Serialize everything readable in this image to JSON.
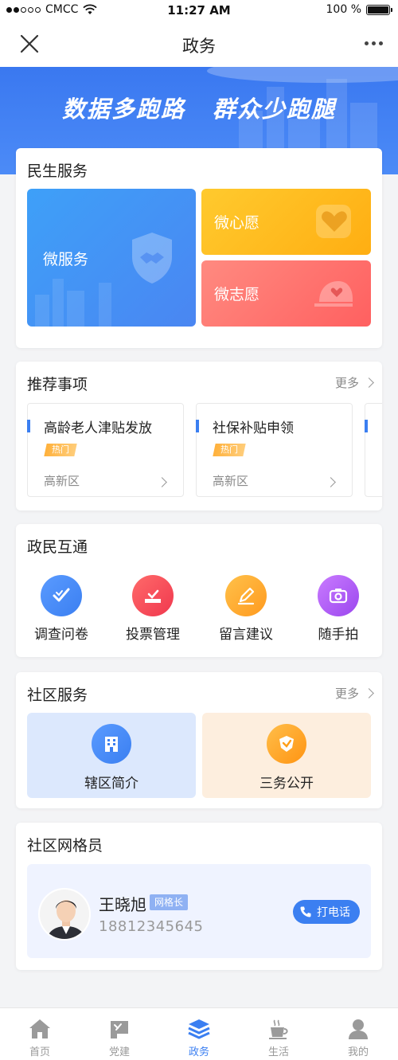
{
  "status_bar": {
    "carrier": "CMCC",
    "time": "11:27 AM",
    "battery": "100 %",
    "battery_level": 1.0
  },
  "nav": {
    "title": "政务",
    "icons": {
      "close": "close-icon",
      "more": "more-dots-icon"
    }
  },
  "banner": {
    "slogan_left": "数据多跑路",
    "slogan_right": "群众少跑腿"
  },
  "livelihood": {
    "title": "民生服务",
    "tiles": [
      {
        "label": "微服务",
        "icon": "handshake-shield-icon",
        "color": "#4a8ff5"
      },
      {
        "label": "微心愿",
        "icon": "heart-icon",
        "color": "#ffb81c"
      },
      {
        "label": "微志愿",
        "icon": "volunteer-cap-icon",
        "color": "#ff6b6b"
      }
    ]
  },
  "recommended": {
    "title": "推荐事项",
    "more": "更多",
    "items": [
      {
        "title": "高龄老人津贴发放",
        "tag": "热门",
        "area": "高新区"
      },
      {
        "title": "社保补贴申领",
        "tag": "热门",
        "area": "高新区"
      }
    ]
  },
  "interaction": {
    "title": "政民互通",
    "tools": [
      {
        "label": "调查问卷",
        "icon": "survey-check-icon",
        "color": "#3b7ff1"
      },
      {
        "label": "投票管理",
        "icon": "vote-box-icon",
        "color": "#f24b5c"
      },
      {
        "label": "留言建议",
        "icon": "pencil-icon",
        "color": "#ffa726"
      },
      {
        "label": "随手拍",
        "icon": "camera-icon",
        "color": "#b15cf0"
      }
    ]
  },
  "community": {
    "title": "社区服务",
    "more": "更多",
    "tiles": [
      {
        "label": "辖区简介",
        "icon": "building-icon",
        "color": "#3b7ff1"
      },
      {
        "label": "三务公开",
        "icon": "badge-shield-icon",
        "color": "#ff9f1a"
      }
    ]
  },
  "grid_member": {
    "title": "社区网格员",
    "name": "王晓旭",
    "role": "网格长",
    "phone": "18812345645",
    "call_label": "打电话"
  },
  "tab_bar": {
    "tabs": [
      {
        "label": "首页",
        "icon": "home-icon",
        "active": false
      },
      {
        "label": "党建",
        "icon": "party-flag-icon",
        "active": false
      },
      {
        "label": "政务",
        "icon": "layers-icon",
        "active": true
      },
      {
        "label": "生活",
        "icon": "coffee-cup-icon",
        "active": false
      },
      {
        "label": "我的",
        "icon": "user-icon",
        "active": false
      }
    ]
  },
  "colors": {
    "primary": "#3b7ff1",
    "hot_tag": "#ffb13c"
  }
}
